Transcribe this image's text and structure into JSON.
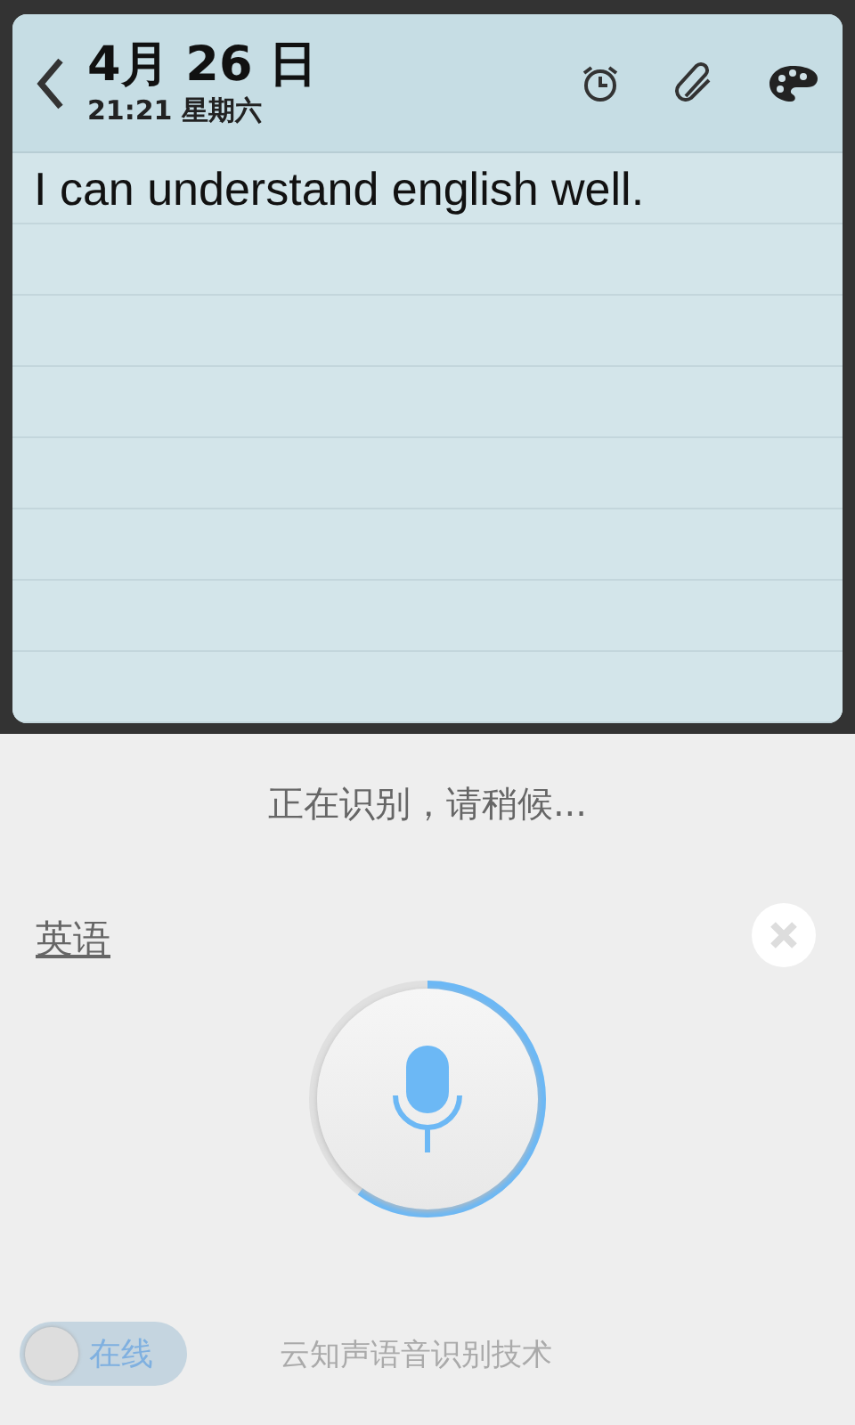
{
  "note": {
    "date": "4月 26 日",
    "time": "21:21 星期六",
    "text": "I can understand english well."
  },
  "voice": {
    "status": "正在识别，请稍候...",
    "language": "英语",
    "level": 0.6,
    "online": {
      "label": "在线",
      "on": false
    },
    "credit": "云知声语音识别技术"
  }
}
